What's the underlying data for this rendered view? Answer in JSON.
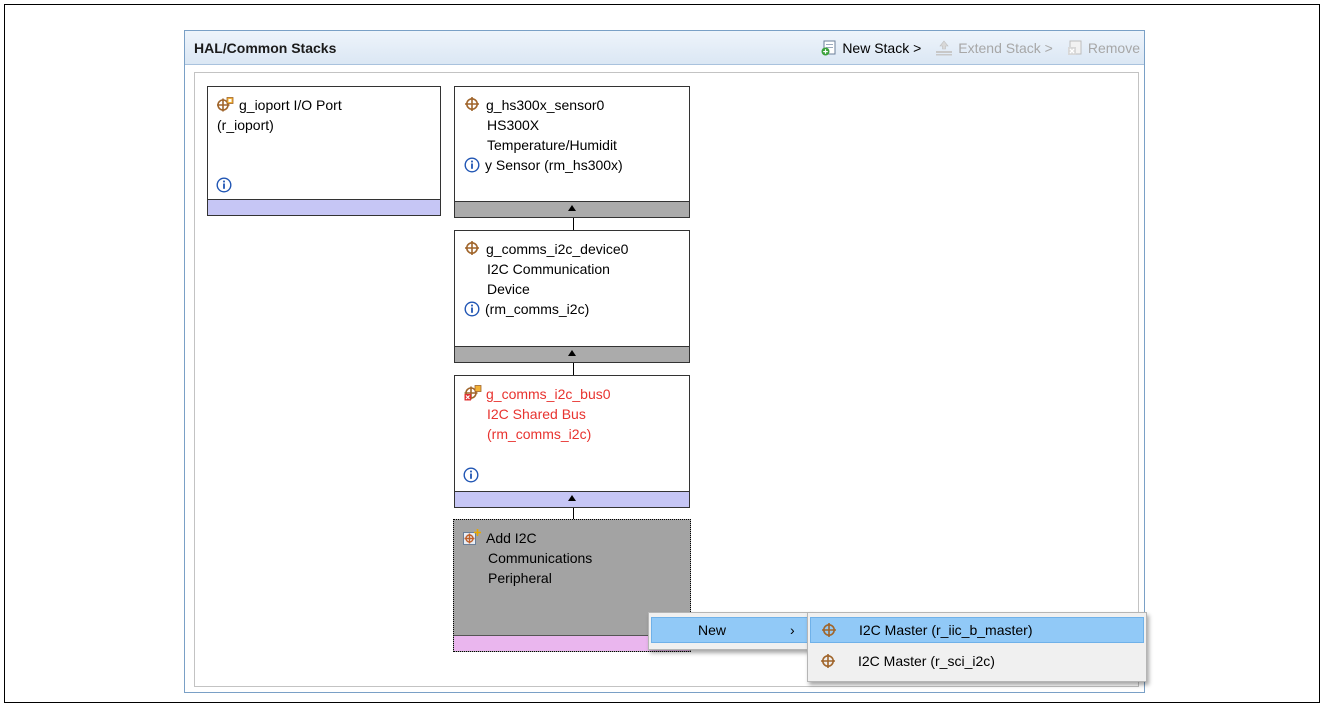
{
  "panel": {
    "title": "HAL/Common Stacks",
    "toolbar": {
      "new_stack": "New Stack >",
      "extend_stack": "Extend Stack >",
      "remove": "Remove"
    }
  },
  "cards": {
    "ioport": {
      "line1": "g_ioport I/O Port",
      "line2": "(r_ioport)"
    },
    "hs300x": {
      "line1": "g_hs300x_sensor0",
      "line2": "HS300X",
      "line3": "Temperature/Humidit",
      "line4": "y Sensor (rm_hs300x)"
    },
    "i2c_device": {
      "line1": "g_comms_i2c_device0",
      "line2": "I2C Communication",
      "line3": "Device",
      "line4": "(rm_comms_i2c)"
    },
    "i2c_bus": {
      "line1": "g_comms_i2c_bus0",
      "line2": "I2C Shared Bus",
      "line3": "(rm_comms_i2c)"
    },
    "add_peripheral": {
      "line1": "Add I2C",
      "line2": "Communications",
      "line3": "Peripheral"
    }
  },
  "context_menu": {
    "new_label": "New",
    "submenu": [
      {
        "label": "I2C Master (r_iic_b_master)",
        "selected": true
      },
      {
        "label": "I2C Master (r_sci_i2c)",
        "selected": false
      }
    ]
  },
  "colors": {
    "error_text": "#e8332f",
    "footer_blue": "#c6c6f5",
    "footer_gray": "#ababab",
    "footer_pink": "#eab6ee",
    "menu_highlight": "#91c9f7"
  }
}
